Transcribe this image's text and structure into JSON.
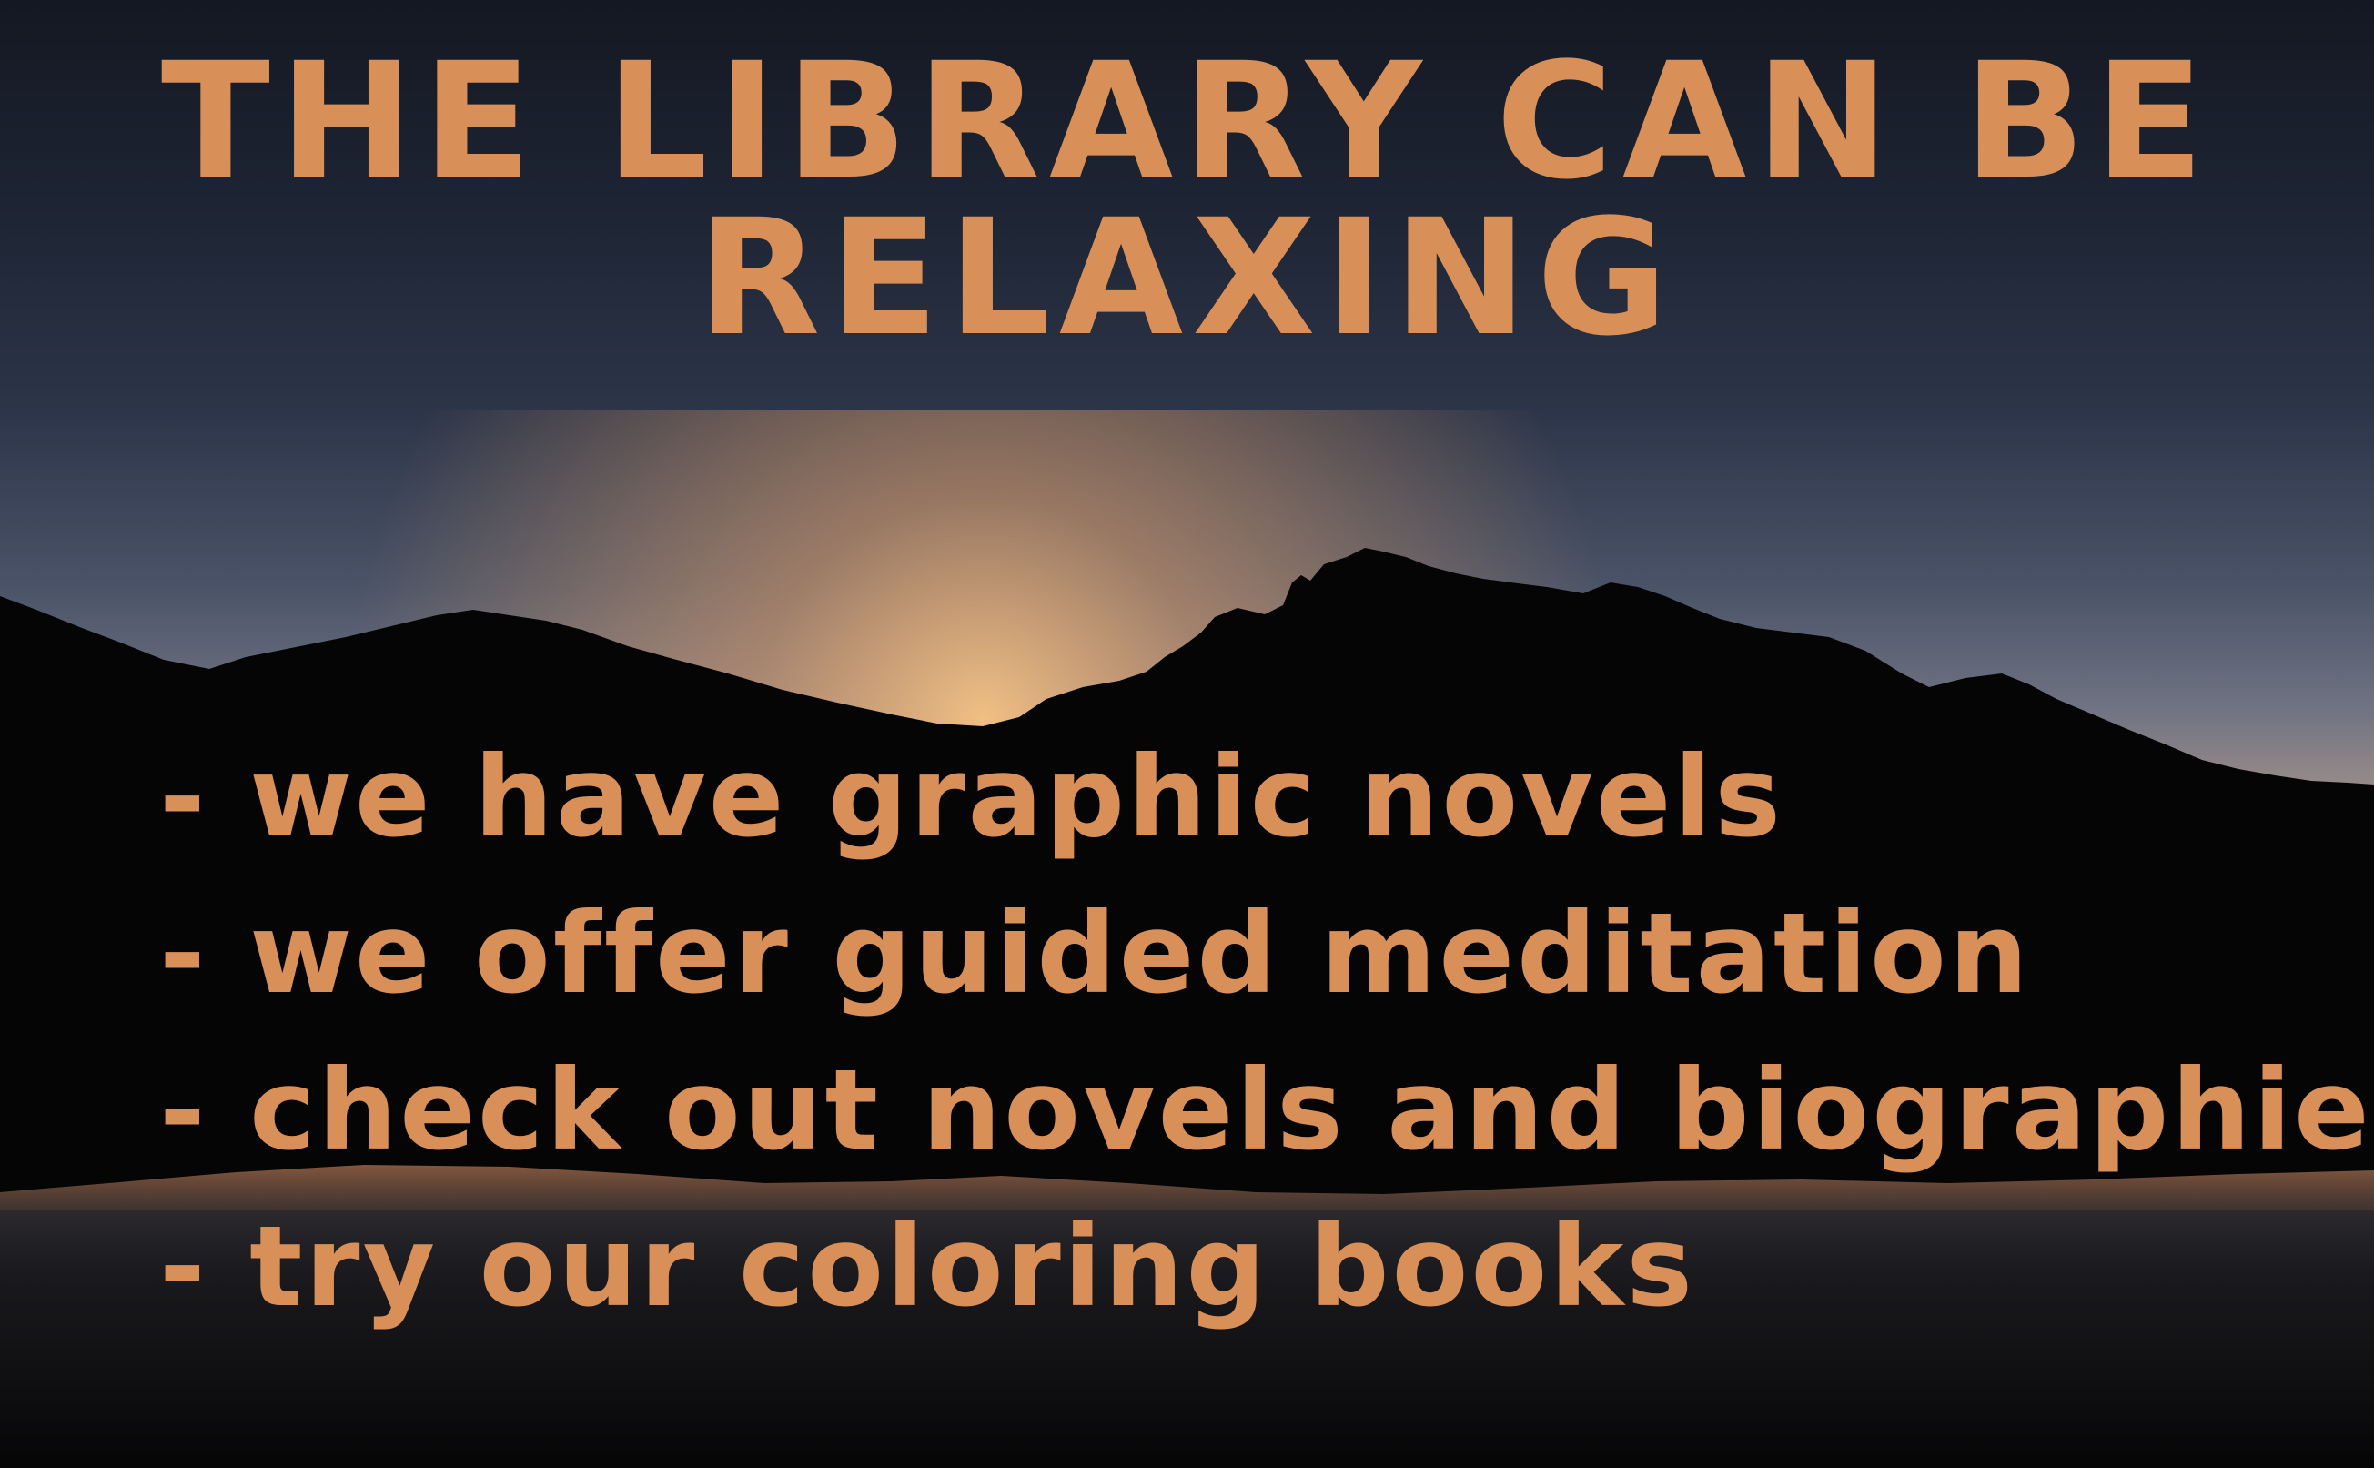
{
  "title": {
    "line1": "THE LIBRARY CAN BE",
    "line2": "RELAXING"
  },
  "bullets": [
    "- we have graphic novels",
    "- we offer guided meditation",
    "- check out novels and biographies",
    "- try our coloring books"
  ],
  "colors": {
    "text": "#d89058",
    "sky_top": "#141822",
    "sky_mid": "#4a5367",
    "horizon_glow": "#e8a872",
    "mountains": "#050506"
  }
}
